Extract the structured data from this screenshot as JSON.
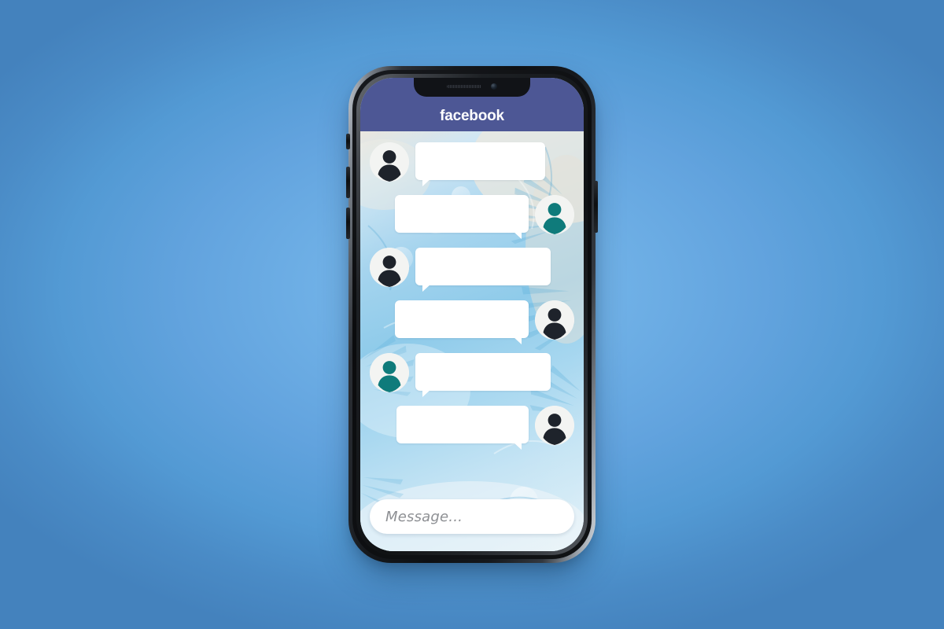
{
  "background": {
    "style": "radial-gradient-blue",
    "center_color": "#79b8ea",
    "edge_color": "#4482bd"
  },
  "device": {
    "type": "smartphone-mockup",
    "frame_color": "#0e1013",
    "bezel_highlight": "#cdd3da",
    "notch": {
      "speaker": "speaker-grille",
      "camera": "front-camera"
    },
    "buttons": [
      {
        "name": "silent-switch",
        "side": "left"
      },
      {
        "name": "volume-up-button",
        "side": "left"
      },
      {
        "name": "volume-down-button",
        "side": "left"
      },
      {
        "name": "power-button",
        "side": "right"
      }
    ]
  },
  "app": {
    "header": {
      "title": "facebook",
      "background_color": "#4d5795",
      "text_color": "#ffffff"
    },
    "wallpaper": {
      "description": "tropical-palm-leaf-watercolor",
      "base_color": "#8fcbea",
      "accent_color": "#e8e4dc"
    },
    "bubble_color": "#ffffff",
    "avatar_colors": {
      "dark": "#1e232b",
      "teal": "#0f7b7b",
      "circle_background": "#f3f4f2"
    },
    "messages": [
      {
        "id": 1,
        "direction": "incoming",
        "avatar": "dark",
        "avatar_side": "left",
        "text": "",
        "bubble_width": "w-165"
      },
      {
        "id": 2,
        "direction": "outgoing",
        "avatar": "teal",
        "avatar_side": "right",
        "text": "",
        "bubble_width": "w-170"
      },
      {
        "id": 3,
        "direction": "incoming",
        "avatar": "dark",
        "avatar_side": "left",
        "text": "",
        "bubble_width": "w-172"
      },
      {
        "id": 4,
        "direction": "outgoing",
        "avatar": "dark",
        "avatar_side": "right",
        "text": "",
        "bubble_width": "w-170"
      },
      {
        "id": 5,
        "direction": "incoming",
        "avatar": "teal",
        "avatar_side": "left",
        "text": "",
        "bubble_width": "w-172"
      },
      {
        "id": 6,
        "direction": "outgoing",
        "avatar": "dark",
        "avatar_side": "right",
        "text": "",
        "bubble_width": "w-168"
      }
    ],
    "composer": {
      "placeholder": "Message...",
      "value": "",
      "background_color": "#ffffff",
      "placeholder_color": "#8d8f93"
    }
  }
}
